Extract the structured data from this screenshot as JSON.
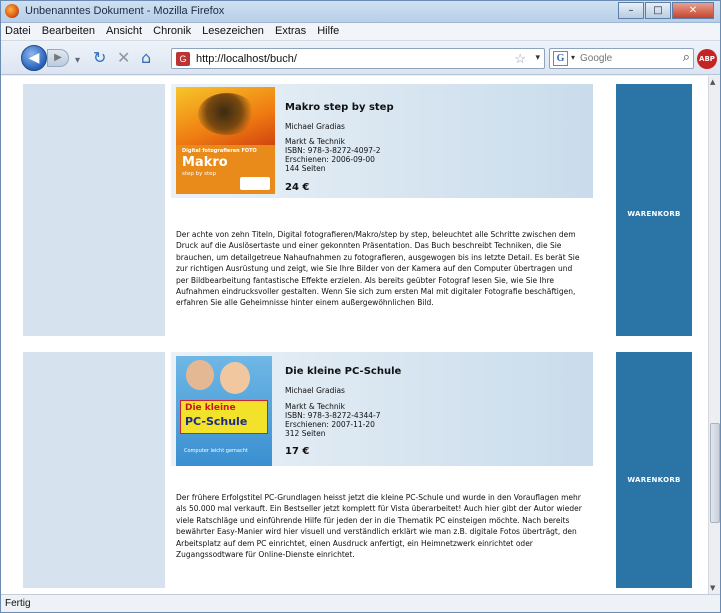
{
  "window": {
    "title": "Unbenanntes Dokument - Mozilla Firefox",
    "minimize": "–",
    "maximize": "□",
    "close": "✕"
  },
  "menu": [
    "Datei",
    "Bearbeiten",
    "Ansicht",
    "Chronik",
    "Lesezeichen",
    "Extras",
    "Hilfe"
  ],
  "nav": {
    "url": "http://localhost/buch/",
    "search_placeholder": "Google",
    "search_engine_letter": "G",
    "adblock_label": "ABP"
  },
  "cart_label": "WARENKORB",
  "books": [
    {
      "title": "Makro step by step",
      "author": "Michael Gradias",
      "publisher": "Markt & Technik",
      "isbn": "ISBN: 978-3-8272-4097-2",
      "published": "Erschienen: 2006-09-00",
      "pages": "144 Seiten",
      "price": "24 €",
      "cover": {
        "series": "Digital fotografieren FOTO",
        "main": "Makro",
        "sub": "step by step"
      },
      "description": "Der achte von zehn Titeln, Digital fotografieren/Makro/step by step, beleuchtet alle Schritte zwischen dem Druck auf die Auslösertaste und einer gekonnten Präsentation. Das Buch beschreibt Techniken, die Sie brauchen, um detailgetreue Nahaufnahmen zu fotografieren, ausgewogen bis ins letzte Detail. Es berät Sie zur richtigen Ausrüstung und zeigt, wie Sie Ihre Bilder von der Kamera auf den Computer übertragen und per Bildbearbeitung fantastische Effekte erzielen. Als bereits geübter Fotograf lesen Sie, wie Sie Ihre Aufnahmen eindrucksvoller gestalten. Wenn Sie sich zum ersten Mal mit digitaler Fotografie beschäftigen, erfahren Sie alle Geheimnisse hinter einem außergewöhnlichen Bild."
    },
    {
      "title": "Die kleine PC-Schule",
      "author": "Michael Gradias",
      "publisher": "Markt & Technik",
      "isbn": "ISBN: 978-3-8272-4344-7",
      "published": "Erschienen: 2007-11-20",
      "pages": "312 Seiten",
      "price": "17 €",
      "cover": {
        "line1": "Die kleine",
        "line2": "PC-Schule",
        "sub": "Computer leicht gemacht"
      },
      "description": "Der frühere Erfolgstitel PC-Grundlagen heisst jetzt die kleine PC-Schule und wurde in den Vorauflagen mehr als 50.000 mal verkauft. Ein Bestseller jetzt komplett für Vista überarbeitet! Auch hier gibt der Autor wieder viele Ratschläge und einführende Hilfe für jeden der in die Thematik PC einsteigen möchte. Nach bereits bewährter Easy-Manier wird hier visuell und verständlich erklärt wie man z.B. digitale Fotos überträgt, den Arbeitsplatz auf dem PC einrichtet, einen Ausdruck anfertigt, ein Heimnetzwerk einrichtet oder Zugangssodtware für Online-Dienste einrichtet."
    }
  ],
  "status": "Fertig",
  "colors": {
    "cart_bg": "#2a74a6",
    "side_panel": "#d6e3ee"
  }
}
